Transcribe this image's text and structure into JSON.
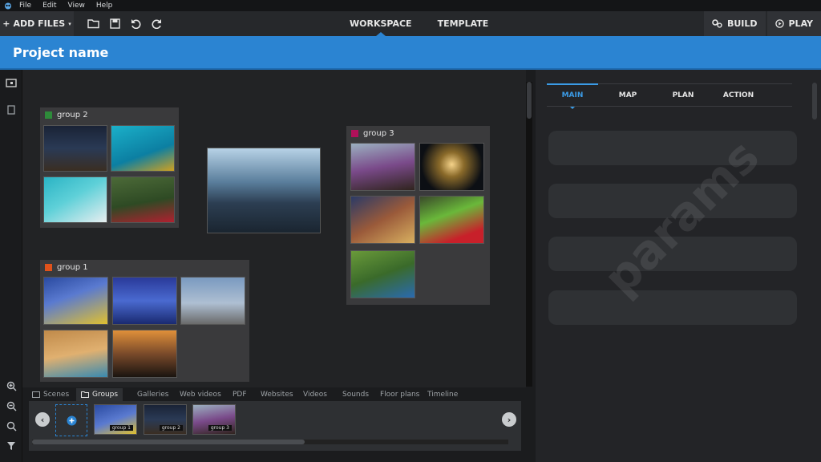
{
  "menu": {
    "items": [
      "File",
      "Edit",
      "View",
      "Help"
    ]
  },
  "toolbar": {
    "add_files": "ADD FILES",
    "tabs": [
      "WORKSPACE",
      "TEMPLATE"
    ],
    "build": "BUILD",
    "play": "PLAY"
  },
  "project": {
    "name": "Project name"
  },
  "groups": [
    {
      "label": "group 2",
      "color": "#2e8b3a"
    },
    {
      "label": "group 3",
      "color": "#b0105a"
    },
    {
      "label": "group 1",
      "color": "#e0521b"
    }
  ],
  "bottom_tabs": [
    "Scenes",
    "Groups",
    "Galleries",
    "Web videos",
    "PDF",
    "Websites",
    "Videos",
    "Sounds",
    "Floor plans",
    "Timeline"
  ],
  "strip_items": [
    "group 1",
    "group 2",
    "group 3"
  ],
  "right_tabs": [
    "MAIN",
    "MAP",
    "PLAN",
    "ACTION"
  ],
  "watermark": "params",
  "colors": {
    "accent": "#2b84d2"
  }
}
